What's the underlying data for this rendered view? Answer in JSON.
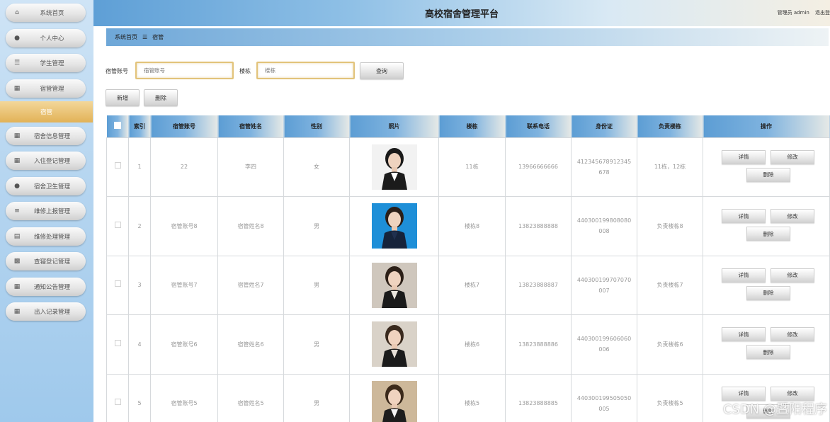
{
  "header": {
    "title": "高校宿舍管理平台",
    "user_label": "管理员 admin",
    "logout_label": "退出登"
  },
  "sidebar": {
    "items": [
      {
        "label": "系统首页",
        "icon": "home-icon"
      },
      {
        "label": "个人中心",
        "icon": "user-icon"
      },
      {
        "label": "学生管理",
        "icon": "list-icon"
      },
      {
        "label": "宿管管理",
        "icon": "grid-icon"
      }
    ],
    "active": {
      "label": "宿管"
    },
    "items2": [
      {
        "label": "宿舍信息管理",
        "icon": "grid-icon"
      },
      {
        "label": "入住登记管理",
        "icon": "grid-icon"
      },
      {
        "label": "宿舍卫生管理",
        "icon": "user-icon"
      },
      {
        "label": "维修上报管理",
        "icon": "stack-icon"
      },
      {
        "label": "维修处理管理",
        "icon": "doc-icon"
      },
      {
        "label": "查寝登记管理",
        "icon": "table-icon"
      },
      {
        "label": "通知公告管理",
        "icon": "grid-icon"
      },
      {
        "label": "出入记录管理",
        "icon": "grid-icon"
      }
    ]
  },
  "breadcrumb": {
    "home": "系统首页",
    "sep": "☰",
    "current": "宿管"
  },
  "search": {
    "account_label": "宿管账号",
    "account_placeholder": "宿管账号",
    "building_label": "楼栋",
    "building_placeholder": "楼栋",
    "query_label": "查询"
  },
  "actions": {
    "add_label": "新增",
    "delete_label": "删除"
  },
  "table": {
    "headers": [
      "",
      "索引",
      "宿管账号",
      "宿管姓名",
      "性别",
      "照片",
      "楼栋",
      "联系电话",
      "身份证",
      "负责楼栋",
      "操作"
    ],
    "op_labels": {
      "detail": "详情",
      "edit": "修改",
      "delete": "删除"
    },
    "rows": [
      {
        "index": "1",
        "account": "22",
        "name": "李四",
        "gender": "女",
        "building": "11栋",
        "phone": "13966666666",
        "id_line1": "412345678912345",
        "id_line2": "678",
        "managed": "11栋，12栋",
        "photo": "portrait-photo-1"
      },
      {
        "index": "2",
        "account": "宿管账号8",
        "name": "宿管姓名8",
        "gender": "男",
        "building": "楼栋8",
        "phone": "13823888888",
        "id_line1": "440300199808080",
        "id_line2": "008",
        "managed": "负责楼栋8",
        "photo": "portrait-photo-2"
      },
      {
        "index": "3",
        "account": "宿管账号7",
        "name": "宿管姓名7",
        "gender": "男",
        "building": "楼栋7",
        "phone": "13823888887",
        "id_line1": "440300199707070",
        "id_line2": "007",
        "managed": "负责楼栋7",
        "photo": "portrait-photo-3"
      },
      {
        "index": "4",
        "account": "宿管账号6",
        "name": "宿管姓名6",
        "gender": "男",
        "building": "楼栋6",
        "phone": "13823888886",
        "id_line1": "440300199606060",
        "id_line2": "006",
        "managed": "负责楼栋6",
        "photo": "portrait-photo-4"
      },
      {
        "index": "5",
        "account": "宿管账号5",
        "name": "宿管姓名5",
        "gender": "男",
        "building": "楼栋5",
        "phone": "13823888885",
        "id_line1": "440300199505050",
        "id_line2": "005",
        "managed": "负责楼栋5",
        "photo": "portrait-photo-5"
      }
    ]
  },
  "watermark": "CSDN @暨阳程序",
  "colors": {
    "accent_gold": "#e2b257",
    "header_blue": "#5e9fd6",
    "table_header": "#7fb3df"
  }
}
